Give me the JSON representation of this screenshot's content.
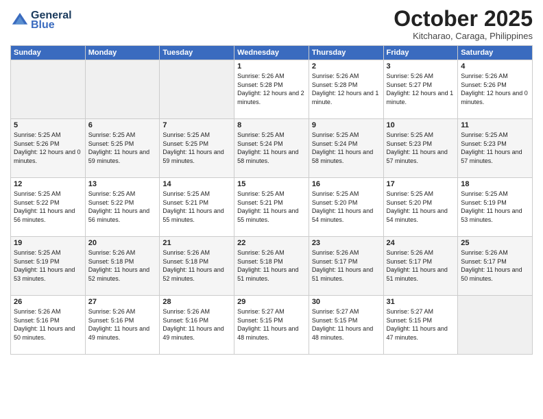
{
  "header": {
    "logo_line1": "General",
    "logo_line2": "Blue",
    "month": "October 2025",
    "location": "Kitcharao, Caraga, Philippines"
  },
  "days_of_week": [
    "Sunday",
    "Monday",
    "Tuesday",
    "Wednesday",
    "Thursday",
    "Friday",
    "Saturday"
  ],
  "weeks": [
    [
      {
        "day": "",
        "empty": true
      },
      {
        "day": "",
        "empty": true
      },
      {
        "day": "",
        "empty": true
      },
      {
        "day": "1",
        "sunrise": "5:26 AM",
        "sunset": "5:28 PM",
        "daylight": "12 hours and 2 minutes."
      },
      {
        "day": "2",
        "sunrise": "5:26 AM",
        "sunset": "5:28 PM",
        "daylight": "12 hours and 1 minute."
      },
      {
        "day": "3",
        "sunrise": "5:26 AM",
        "sunset": "5:27 PM",
        "daylight": "12 hours and 1 minute."
      },
      {
        "day": "4",
        "sunrise": "5:26 AM",
        "sunset": "5:26 PM",
        "daylight": "12 hours and 0 minutes."
      }
    ],
    [
      {
        "day": "5",
        "sunrise": "5:25 AM",
        "sunset": "5:26 PM",
        "daylight": "12 hours and 0 minutes."
      },
      {
        "day": "6",
        "sunrise": "5:25 AM",
        "sunset": "5:25 PM",
        "daylight": "11 hours and 59 minutes."
      },
      {
        "day": "7",
        "sunrise": "5:25 AM",
        "sunset": "5:25 PM",
        "daylight": "11 hours and 59 minutes."
      },
      {
        "day": "8",
        "sunrise": "5:25 AM",
        "sunset": "5:24 PM",
        "daylight": "11 hours and 58 minutes."
      },
      {
        "day": "9",
        "sunrise": "5:25 AM",
        "sunset": "5:24 PM",
        "daylight": "11 hours and 58 minutes."
      },
      {
        "day": "10",
        "sunrise": "5:25 AM",
        "sunset": "5:23 PM",
        "daylight": "11 hours and 57 minutes."
      },
      {
        "day": "11",
        "sunrise": "5:25 AM",
        "sunset": "5:23 PM",
        "daylight": "11 hours and 57 minutes."
      }
    ],
    [
      {
        "day": "12",
        "sunrise": "5:25 AM",
        "sunset": "5:22 PM",
        "daylight": "11 hours and 56 minutes."
      },
      {
        "day": "13",
        "sunrise": "5:25 AM",
        "sunset": "5:22 PM",
        "daylight": "11 hours and 56 minutes."
      },
      {
        "day": "14",
        "sunrise": "5:25 AM",
        "sunset": "5:21 PM",
        "daylight": "11 hours and 55 minutes."
      },
      {
        "day": "15",
        "sunrise": "5:25 AM",
        "sunset": "5:21 PM",
        "daylight": "11 hours and 55 minutes."
      },
      {
        "day": "16",
        "sunrise": "5:25 AM",
        "sunset": "5:20 PM",
        "daylight": "11 hours and 54 minutes."
      },
      {
        "day": "17",
        "sunrise": "5:25 AM",
        "sunset": "5:20 PM",
        "daylight": "11 hours and 54 minutes."
      },
      {
        "day": "18",
        "sunrise": "5:25 AM",
        "sunset": "5:19 PM",
        "daylight": "11 hours and 53 minutes."
      }
    ],
    [
      {
        "day": "19",
        "sunrise": "5:25 AM",
        "sunset": "5:19 PM",
        "daylight": "11 hours and 53 minutes."
      },
      {
        "day": "20",
        "sunrise": "5:26 AM",
        "sunset": "5:18 PM",
        "daylight": "11 hours and 52 minutes."
      },
      {
        "day": "21",
        "sunrise": "5:26 AM",
        "sunset": "5:18 PM",
        "daylight": "11 hours and 52 minutes."
      },
      {
        "day": "22",
        "sunrise": "5:26 AM",
        "sunset": "5:18 PM",
        "daylight": "11 hours and 51 minutes."
      },
      {
        "day": "23",
        "sunrise": "5:26 AM",
        "sunset": "5:17 PM",
        "daylight": "11 hours and 51 minutes."
      },
      {
        "day": "24",
        "sunrise": "5:26 AM",
        "sunset": "5:17 PM",
        "daylight": "11 hours and 51 minutes."
      },
      {
        "day": "25",
        "sunrise": "5:26 AM",
        "sunset": "5:17 PM",
        "daylight": "11 hours and 50 minutes."
      }
    ],
    [
      {
        "day": "26",
        "sunrise": "5:26 AM",
        "sunset": "5:16 PM",
        "daylight": "11 hours and 50 minutes."
      },
      {
        "day": "27",
        "sunrise": "5:26 AM",
        "sunset": "5:16 PM",
        "daylight": "11 hours and 49 minutes."
      },
      {
        "day": "28",
        "sunrise": "5:26 AM",
        "sunset": "5:16 PM",
        "daylight": "11 hours and 49 minutes."
      },
      {
        "day": "29",
        "sunrise": "5:27 AM",
        "sunset": "5:15 PM",
        "daylight": "11 hours and 48 minutes."
      },
      {
        "day": "30",
        "sunrise": "5:27 AM",
        "sunset": "5:15 PM",
        "daylight": "11 hours and 48 minutes."
      },
      {
        "day": "31",
        "sunrise": "5:27 AM",
        "sunset": "5:15 PM",
        "daylight": "11 hours and 47 minutes."
      },
      {
        "day": "",
        "empty": true
      }
    ]
  ]
}
